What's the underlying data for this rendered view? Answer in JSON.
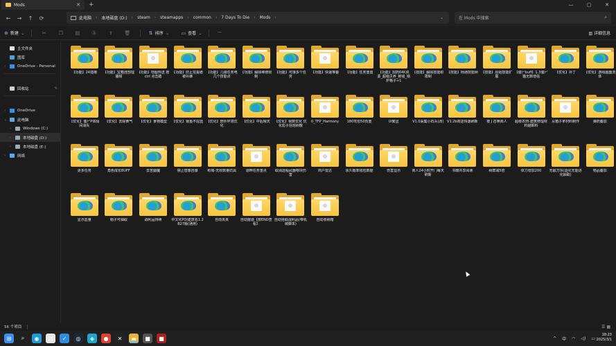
{
  "window": {
    "tab_title": "Mods",
    "tab_close": "✕",
    "new_tab": "+",
    "minimize": "—",
    "maximize": "▢",
    "close": "✕"
  },
  "nav": {
    "back": "←",
    "forward": "→",
    "up": "↑",
    "refresh": "⟳"
  },
  "breadcrumb": [
    "此电脑",
    "本地磁盘 (D:)",
    "steam",
    "steamapps",
    "common",
    "7 Days To Die",
    "Mods"
  ],
  "breadcrumb_sep": "›",
  "address_dropdown": "⌄",
  "search": {
    "placeholder": "在 Mods 中搜索",
    "icon": "⌕"
  },
  "toolbar": {
    "new_label": "新建",
    "sort_label": "排序",
    "view_label": "查看",
    "more": "···",
    "details_label": "详细信息"
  },
  "sidebar": [
    {
      "label": "主文件夹",
      "color": "#e3e3e3",
      "arrow": "",
      "pin": ""
    },
    {
      "label": "图库",
      "color": "#4aa3e0",
      "arrow": "",
      "pin": ""
    },
    {
      "label": "OneDrive - Personal",
      "color": "#3a8ee6",
      "arrow": "›",
      "pin": ""
    },
    {
      "label": "回收站",
      "color": "#cfcfcf",
      "arrow": "",
      "pin": "✎"
    },
    {
      "label": "OneDrive",
      "color": "#3a8ee6",
      "arrow": "›",
      "pin": ""
    },
    {
      "label": "此电脑",
      "color": "#5fa8e8",
      "arrow": "⌄",
      "pin": ""
    },
    {
      "label": "Windows (C:)",
      "color": "#9ab",
      "arrow": "›",
      "pin": ""
    },
    {
      "label": "本地磁盘 (D:)",
      "color": "#9ab",
      "arrow": "›",
      "pin": ""
    },
    {
      "label": "本地磁盘 (E:)",
      "color": "#9ab",
      "arrow": "›",
      "pin": ""
    },
    {
      "label": "网络",
      "color": "#5fa8e8",
      "arrow": "›",
      "pin": ""
    }
  ],
  "folders": [
    {
      "name": "【功能】24插槽",
      "style": "edge"
    },
    {
      "name": "【功能】宝箱连部理播频",
      "style": "edge"
    },
    {
      "name": "【功能】地图传送 按ctrl 点击踏",
      "style": "doc"
    },
    {
      "name": "【功能】防止挖掘者被补蜂",
      "style": "edge"
    },
    {
      "name": "【功能】几级任务电几个技能点",
      "style": "edge"
    },
    {
      "name": "【功能】解除维修限制",
      "style": "edge"
    },
    {
      "name": "【功能】可接多个任务",
      "style": "edge"
    },
    {
      "name": "【功能】快速堆叠",
      "style": "doc"
    },
    {
      "name": "【功能】任务重置",
      "style": "edge"
    },
    {
      "name": "【功能】加药64K资源_超级贝养_制钱_锅炉格子+1",
      "style": "edge"
    },
    {
      "name": "【技能】解除技能职限制",
      "style": "edge"
    },
    {
      "name": "【技能】杨通技能树",
      "style": "edge"
    },
    {
      "name": "【技能】原始技能扩展",
      "style": "edge"
    },
    {
      "name": "【僵尸buff】1.3僵尸猫无数增强",
      "style": "doc"
    },
    {
      "name": "【优化】补丁",
      "style": "edge"
    },
    {
      "name": "【优化】游戏画面流体",
      "style": "edge"
    },
    {
      "name": "【优化】僵尸P体隔间消失",
      "style": "edge"
    },
    {
      "name": "【优化】去除黄气",
      "style": "edge"
    },
    {
      "name": "【优化】食物模型",
      "style": "edge"
    },
    {
      "name": "【优化】锁鱼不屈蓝",
      "style": "edge"
    },
    {
      "name": "【优化】野外环境优化",
      "style": "edge"
    },
    {
      "name": "【优化】中后晴天",
      "style": "edge"
    },
    {
      "name": "【优化】帧数优化 优化彪子信熔树散",
      "style": "edge"
    },
    {
      "name": "0_TFP_Harmony",
      "style": "doc"
    },
    {
      "name": "180驾包50负重",
      "style": "edge"
    },
    {
      "name": "UI繁显",
      "style": "doc"
    },
    {
      "name": "V1.0采集小石头(改)",
      "style": "edge"
    },
    {
      "name": "V1.2b商店快速刷新",
      "style": "edge"
    },
    {
      "name": "按 J 召唤商人",
      "style": "edge"
    },
    {
      "name": "超级农田-建筑修理材料越卸料",
      "style": "edge"
    },
    {
      "name": "从箱子拿材料制作",
      "style": "doc"
    },
    {
      "name": "弹药叠加",
      "style": "edge"
    },
    {
      "name": "更多任务",
      "style": "edge"
    },
    {
      "name": "角色成长BUFF",
      "style": "edge"
    },
    {
      "name": "去苦腿魔",
      "style": "edge"
    },
    {
      "name": "禁止替像自爆",
      "style": "edge"
    },
    {
      "name": "枪械-无限数量防具",
      "style": "edge"
    },
    {
      "name": "道畔任务重点",
      "style": "doc"
    },
    {
      "name": "取消远程武器物块伤害",
      "style": "edge"
    },
    {
      "name": "商户雷达",
      "style": "doc"
    },
    {
      "name": "永久概率钱包数据",
      "style": "edge"
    },
    {
      "name": "伤害显示",
      "style": "doc"
    },
    {
      "name": "商人24小时开门每天刷新",
      "style": "edge"
    },
    {
      "name": "书籍共享阅读",
      "style": "edge"
    },
    {
      "name": "树葬减5倍",
      "style": "edge"
    },
    {
      "name": "体力增加200",
      "style": "edge"
    },
    {
      "name": "无敌方块(退化无能进化抽取)",
      "style": "edge"
    },
    {
      "name": "物品叠加",
      "style": "edge"
    },
    {
      "name": "显示血量",
      "style": "edge"
    },
    {
      "name": "帽子可抽取",
      "style": "edge"
    },
    {
      "name": "战利品持续",
      "style": "edge"
    },
    {
      "name": "中文化POI建筑名1.2B27版(通用)",
      "style": "edge"
    },
    {
      "name": "自动夹夹",
      "style": "edge"
    },
    {
      "name": "自动隧道【按END查看】",
      "style": "doc"
    },
    {
      "name": "自动拾取战利品(带机械脚本)",
      "style": "doc"
    },
    {
      "name": "自动收纳箱",
      "style": "doc"
    }
  ],
  "status": {
    "count": "56 个项目",
    "cursor_bar": "|"
  },
  "taskbar": [
    {
      "name": "start",
      "glyph": "⊞",
      "color": "#3b8ff0"
    },
    {
      "name": "search",
      "glyph": "⌕",
      "color": "transparent"
    },
    {
      "name": "edge",
      "glyph": "◉",
      "color": "#1d9bd7"
    },
    {
      "name": "store",
      "glyph": "⊙",
      "color": "#e6e6e6"
    },
    {
      "name": "app-blue",
      "glyph": "✓",
      "color": "#2f8ae0"
    },
    {
      "name": "app-steam",
      "glyph": "◎",
      "color": "#1b2838"
    },
    {
      "name": "app-cyan",
      "glyph": "◈",
      "color": "#20a6c8"
    },
    {
      "name": "app-chrome",
      "glyph": "●",
      "color": "#db4437"
    },
    {
      "name": "app-x",
      "glyph": "✕",
      "color": "#222"
    },
    {
      "name": "explorer",
      "glyph": "▬",
      "color": "#e8b53c"
    },
    {
      "name": "app-gray",
      "glyph": "■",
      "color": "#555"
    },
    {
      "name": "app-red",
      "glyph": "■",
      "color": "#b02020"
    }
  ],
  "tray": {
    "chevron": "^",
    "ime": "中",
    "wifi": "◠",
    "volume": "◁)",
    "battery": "▭"
  },
  "clock": {
    "time": "18:23",
    "date": "2025/3/1"
  }
}
